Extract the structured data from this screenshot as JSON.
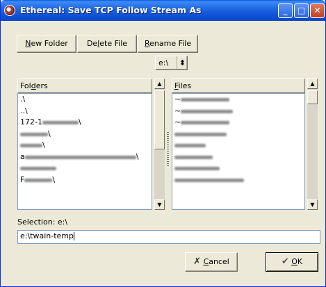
{
  "window": {
    "title": "Ethereal: Save TCP Follow Stream As",
    "minimize_glyph": "_",
    "maximize_glyph": "□",
    "close_glyph": "✕"
  },
  "toolbar": {
    "new_folder": {
      "pre": "",
      "key": "N",
      "post": "ew Folder"
    },
    "delete_file": {
      "pre": "De",
      "key": "l",
      "post": "ete File"
    },
    "rename_file": {
      "pre": "",
      "key": "R",
      "post": "ename File"
    }
  },
  "drive_select": {
    "value": "e:\\",
    "arrows": "⬍"
  },
  "folders": {
    "header": {
      "pre": "Fol",
      "key": "d",
      "post": "ers"
    },
    "items": [
      {
        "text": ".\\",
        "blur": 0
      },
      {
        "text": "..\\",
        "blur": 0
      },
      {
        "text": "172-1",
        "blur": 52,
        "suffix": "\\"
      },
      {
        "text": "",
        "blur": 40,
        "suffix": "\\"
      },
      {
        "text": "",
        "blur": 32,
        "suffix": "\\"
      },
      {
        "text": "a",
        "blur": 160,
        "suffix": "\\"
      },
      {
        "text": "",
        "blur": 52,
        "suffix": ""
      },
      {
        "text": "F",
        "blur": 40,
        "suffix": "\\"
      }
    ]
  },
  "files": {
    "header": {
      "pre": "",
      "key": "F",
      "post": "iles"
    },
    "items": [
      {
        "text": "~",
        "blur": 70
      },
      {
        "text": "~",
        "blur": 75
      },
      {
        "text": "~",
        "blur": 70
      },
      {
        "text": "",
        "blur": 75
      },
      {
        "text": "",
        "blur": 45
      },
      {
        "text": "",
        "blur": 55
      },
      {
        "text": "",
        "blur": 65
      },
      {
        "text": "",
        "blur": 100
      }
    ]
  },
  "selection": {
    "label": "Selection: e:\\",
    "input_value": "e:\\twain-temp"
  },
  "buttons": {
    "cancel": {
      "pre": "",
      "key": "C",
      "post": "ancel"
    },
    "ok": {
      "pre": "",
      "key": "O",
      "post": "K"
    }
  }
}
